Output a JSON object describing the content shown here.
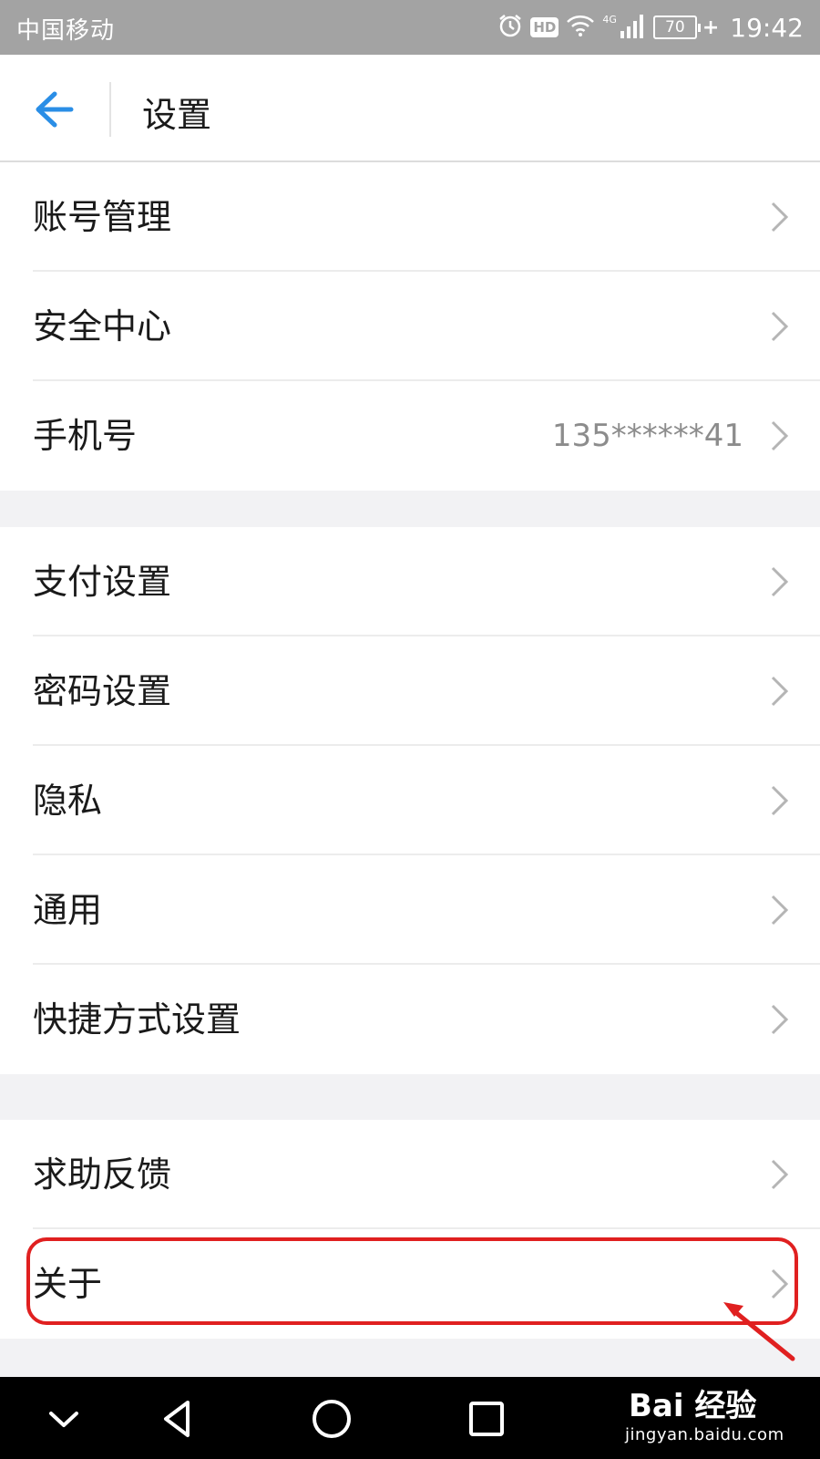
{
  "status_bar": {
    "carrier": "中国移动",
    "hd_label": "HD",
    "network_label": "4G",
    "battery_level": "70",
    "time": "19:42",
    "icons": [
      "alarm-icon",
      "hd-icon",
      "wifi-icon",
      "signal-icon",
      "battery-icon"
    ]
  },
  "header": {
    "title": "设置",
    "back_icon": "back-arrow-icon",
    "accent_color": "#2a8ee6"
  },
  "groups": [
    {
      "items": [
        {
          "label": "账号管理",
          "value": ""
        },
        {
          "label": "安全中心",
          "value": ""
        },
        {
          "label": "手机号",
          "value": "135******41"
        }
      ]
    },
    {
      "items": [
        {
          "label": "支付设置",
          "value": ""
        },
        {
          "label": "密码设置",
          "value": ""
        },
        {
          "label": "隐私",
          "value": ""
        },
        {
          "label": "通用",
          "value": ""
        },
        {
          "label": "快捷方式设置",
          "value": ""
        }
      ]
    },
    {
      "items": [
        {
          "label": "求助反馈",
          "value": ""
        },
        {
          "label": "关于",
          "value": ""
        }
      ]
    }
  ],
  "annotation": {
    "highlight_color": "#e02020",
    "highlighted_item": "关于"
  },
  "nav_bar": {
    "buttons": [
      "chevron-down-icon",
      "back-triangle-icon",
      "home-circle-icon",
      "recents-square-icon"
    ]
  },
  "watermark": {
    "brand": "Bai 经验",
    "url": "jingyan.baidu.com"
  }
}
